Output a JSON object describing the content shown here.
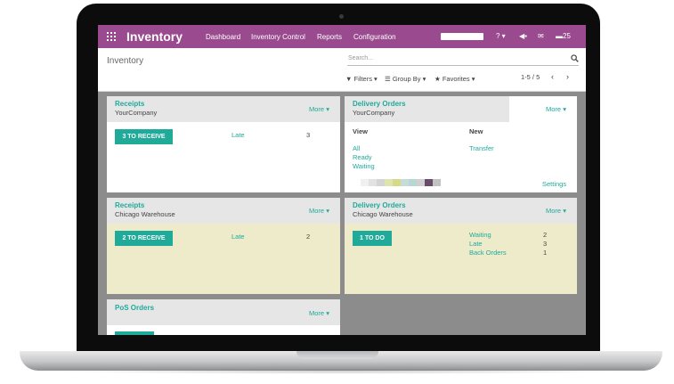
{
  "app": {
    "title": "Inventory",
    "nav": [
      "Dashboard",
      "Inventory Control",
      "Reports",
      "Configuration"
    ],
    "message_count": "25"
  },
  "control_panel": {
    "breadcrumb": "Inventory",
    "search_placeholder": "Search...",
    "filters_label": "Filters",
    "groupby_label": "Group By",
    "favorites_label": "Favorites",
    "pager": "1-5 / 5"
  },
  "cards": {
    "receipts_company": {
      "title": "Receipts",
      "subtitle": "YourCompany",
      "more": "More",
      "button": "3 TO RECEIVE",
      "stat_label": "Late",
      "stat_value": "3"
    },
    "delivery_company": {
      "title": "Delivery Orders",
      "subtitle": "YourCompany",
      "more": "More",
      "view_header": "View",
      "new_header": "New",
      "view_links": [
        "All",
        "Ready",
        "Waiting"
      ],
      "new_link": "Transfer",
      "settings": "Settings",
      "swatch_colors": [
        "#ffffff",
        "#f0f0f0",
        "#e2e2e2",
        "#d4d4d4",
        "#dfe3b0",
        "#d6d986",
        "#c7dbd8",
        "#b6d7d3",
        "#d0d0d0",
        "#6b4b6b",
        "#c2c2c2"
      ]
    },
    "receipts_chicago": {
      "title": "Receipts",
      "subtitle": "Chicago Warehouse",
      "more": "More",
      "button": "2 TO RECEIVE",
      "stat_label": "Late",
      "stat_value": "2"
    },
    "delivery_chicago": {
      "title": "Delivery Orders",
      "subtitle": "Chicago Warehouse",
      "more": "More",
      "button": "1 TO DO",
      "stats": [
        {
          "label": "Waiting",
          "value": "2"
        },
        {
          "label": "Late",
          "value": "3"
        },
        {
          "label": "Back Orders",
          "value": "1"
        }
      ]
    },
    "pos_orders": {
      "title": "PoS Orders",
      "more": "More"
    }
  },
  "colors": {
    "topbar": "#9a4a8e",
    "accent": "#1faa9a",
    "warehouse_card": "#eeebcb",
    "background": "#8c8c8c"
  }
}
